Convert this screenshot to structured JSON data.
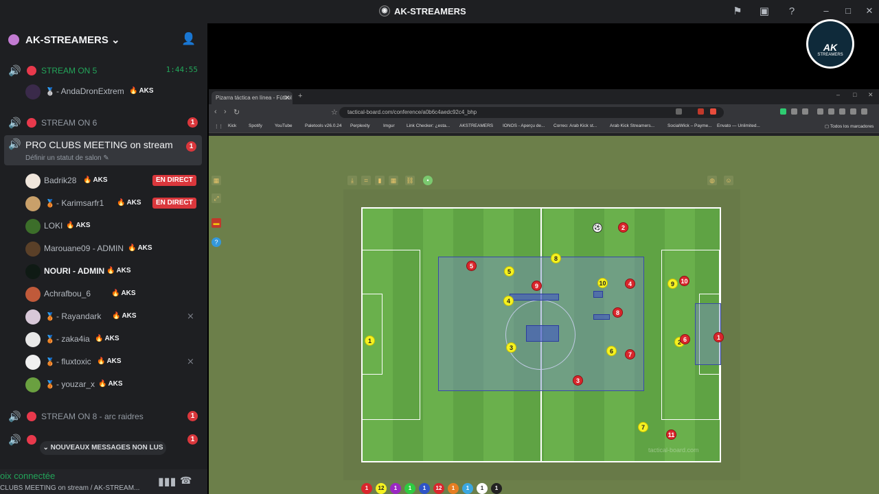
{
  "window": {
    "title": "AK-STREAMERS",
    "logo_icon": "ak-logo-icon"
  },
  "server": {
    "name": "AK-STREAMERS"
  },
  "channels": {
    "stream5": {
      "label": "STREAM ON 5",
      "time": "1:44:55"
    },
    "stream6": {
      "label": "STREAM ON 6",
      "badge": "1"
    },
    "active": {
      "title": "PRO CLUBS MEETING on stream",
      "status": "Définir un statut de salon",
      "badge": "1"
    },
    "stream8": {
      "label": "STREAM ON 8 - arc raidres",
      "badge": "1"
    },
    "stream9": {
      "badge": "1"
    }
  },
  "stream5_member": {
    "name": "- AndaDronExtrem",
    "tag": "AKS"
  },
  "members": [
    {
      "name": "Badrik28",
      "tag": "AKS",
      "live": "EN DIRECT",
      "avatar_color": "#f0e6dc"
    },
    {
      "name": "- Karimsarfr1",
      "tag": "AKS",
      "live": "EN DIRECT",
      "avatar_color": "#c9a06a"
    },
    {
      "name": "LOKI",
      "tag": "AKS",
      "avatar_color": "#3c6e2a"
    },
    {
      "name": "Marouane09 - ADMIN",
      "tag": "AKS",
      "avatar_color": "#5a4028"
    },
    {
      "name": "NOURI - ADMIN",
      "tag": "AKS",
      "avatar_color": "#0f1a14"
    },
    {
      "name": "Achrafbou_6",
      "tag": "AKS",
      "avatar_color": "#c05a3a"
    },
    {
      "name": "- Rayandark",
      "tag": "AKS",
      "avatar_color": "#d8c8d8"
    },
    {
      "name": "- zaka4ia",
      "tag": "AKS",
      "avatar_color": "#e8e8e8"
    },
    {
      "name": "- fluxtoxic",
      "tag": "AKS",
      "avatar_color": "#f0f0f0"
    },
    {
      "name": "- youzar_x",
      "tag": "AKS",
      "avatar_color": "#6aa040"
    }
  ],
  "new_messages": "NOUVEAUX MESSAGES NON LUS",
  "voice": {
    "status": "oix connectée",
    "channel": "CLUBS MEETING on stream / AK-STREAM..."
  },
  "brand": {
    "ak": "AK",
    "sub": "STREAMERS"
  },
  "browser": {
    "tab_title": "Pizarra táctica en línea - Fútbol",
    "url": "tactical-board.com/conference/a0b6c4aedc92c4_bhp",
    "bookmarks": [
      "Kick",
      "Spotify",
      "YouTube",
      "Paletools v26.0.24",
      "Perplexity",
      "Imgur",
      "Link Checker: ¿esta...",
      "AKSTREAMERS",
      "IONOS - Aperçu de...",
      "Correo: Arab Kick st...",
      "Arab Kick Streamers...",
      "SocialWick – Payme...",
      "Envato — Unlimited..."
    ],
    "bookmarks_all": "Todos los marcadores"
  },
  "board": {
    "watermark": "tactical-board.com",
    "yellow_players": [
      "1",
      "2",
      "3",
      "4",
      "5",
      "6",
      "7",
      "8",
      "9",
      "10"
    ],
    "red_players": [
      "1",
      "2",
      "3",
      "4",
      "5",
      "6",
      "7",
      "8",
      "9",
      "10",
      "11"
    ],
    "palette": [
      "1",
      "12",
      "1",
      "1",
      "1",
      "12",
      "1",
      "1",
      "1",
      "1"
    ]
  }
}
